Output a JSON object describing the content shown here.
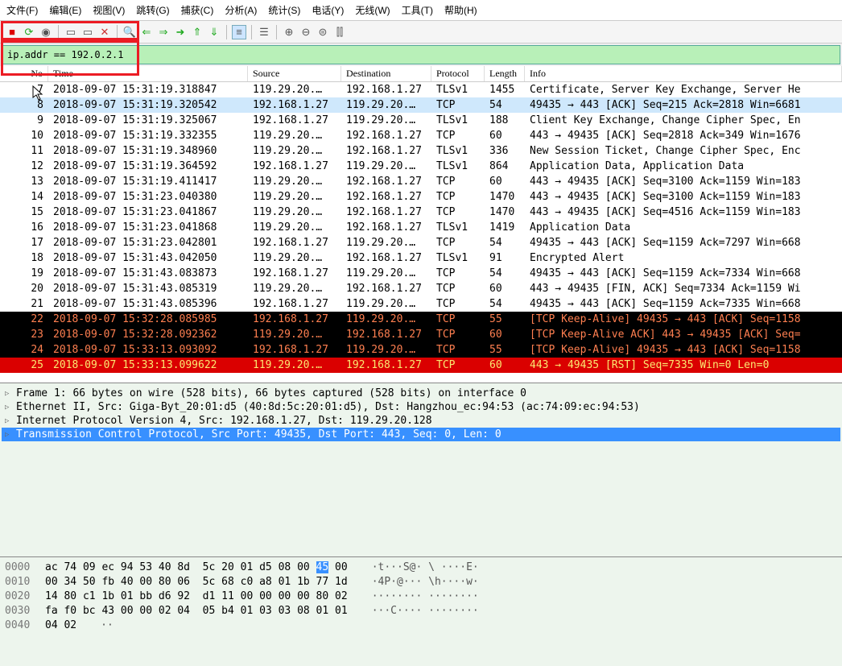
{
  "menu": [
    "文件(F)",
    "编辑(E)",
    "视图(V)",
    "跳转(G)",
    "捕获(C)",
    "分析(A)",
    "统计(S)",
    "电话(Y)",
    "无线(W)",
    "工具(T)",
    "帮助(H)"
  ],
  "filter": {
    "value": "ip.addr == 192.0.2.1"
  },
  "columns": {
    "no": "No",
    "time": "Time",
    "src": "Source",
    "dst": "Destination",
    "proto": "Protocol",
    "len": "Length",
    "info": "Info"
  },
  "packets": [
    {
      "no": 7,
      "time": "2018-09-07 15:31:19.318847",
      "src": "119.29.20.…",
      "dst": "192.168.1.27",
      "proto": "TLSv1",
      "len": 1455,
      "info": "Certificate, Server Key Exchange, Server He",
      "style": "normal"
    },
    {
      "no": 8,
      "time": "2018-09-07 15:31:19.320542",
      "src": "192.168.1.27",
      "dst": "119.29.20.…",
      "proto": "TCP",
      "len": 54,
      "info": "49435 → 443 [ACK] Seq=215 Ack=2818 Win=6681",
      "style": "sel"
    },
    {
      "no": 9,
      "time": "2018-09-07 15:31:19.325067",
      "src": "192.168.1.27",
      "dst": "119.29.20.…",
      "proto": "TLSv1",
      "len": 188,
      "info": "Client Key Exchange, Change Cipher Spec, En",
      "style": "normal"
    },
    {
      "no": 10,
      "time": "2018-09-07 15:31:19.332355",
      "src": "119.29.20.…",
      "dst": "192.168.1.27",
      "proto": "TCP",
      "len": 60,
      "info": "443 → 49435 [ACK] Seq=2818 Ack=349 Win=1676",
      "style": "normal"
    },
    {
      "no": 11,
      "time": "2018-09-07 15:31:19.348960",
      "src": "119.29.20.…",
      "dst": "192.168.1.27",
      "proto": "TLSv1",
      "len": 336,
      "info": "New Session Ticket, Change Cipher Spec, Enc",
      "style": "normal"
    },
    {
      "no": 12,
      "time": "2018-09-07 15:31:19.364592",
      "src": "192.168.1.27",
      "dst": "119.29.20.…",
      "proto": "TLSv1",
      "len": 864,
      "info": "Application Data, Application Data",
      "style": "normal"
    },
    {
      "no": 13,
      "time": "2018-09-07 15:31:19.411417",
      "src": "119.29.20.…",
      "dst": "192.168.1.27",
      "proto": "TCP",
      "len": 60,
      "info": "443 → 49435 [ACK] Seq=3100 Ack=1159 Win=183",
      "style": "normal"
    },
    {
      "no": 14,
      "time": "2018-09-07 15:31:23.040380",
      "src": "119.29.20.…",
      "dst": "192.168.1.27",
      "proto": "TCP",
      "len": 1470,
      "info": "443 → 49435 [ACK] Seq=3100 Ack=1159 Win=183",
      "style": "normal"
    },
    {
      "no": 15,
      "time": "2018-09-07 15:31:23.041867",
      "src": "119.29.20.…",
      "dst": "192.168.1.27",
      "proto": "TCP",
      "len": 1470,
      "info": "443 → 49435 [ACK] Seq=4516 Ack=1159 Win=183",
      "style": "normal"
    },
    {
      "no": 16,
      "time": "2018-09-07 15:31:23.041868",
      "src": "119.29.20.…",
      "dst": "192.168.1.27",
      "proto": "TLSv1",
      "len": 1419,
      "info": "Application Data",
      "style": "normal"
    },
    {
      "no": 17,
      "time": "2018-09-07 15:31:23.042801",
      "src": "192.168.1.27",
      "dst": "119.29.20.…",
      "proto": "TCP",
      "len": 54,
      "info": "49435 → 443 [ACK] Seq=1159 Ack=7297 Win=668",
      "style": "normal"
    },
    {
      "no": 18,
      "time": "2018-09-07 15:31:43.042050",
      "src": "119.29.20.…",
      "dst": "192.168.1.27",
      "proto": "TLSv1",
      "len": 91,
      "info": "Encrypted Alert",
      "style": "normal"
    },
    {
      "no": 19,
      "time": "2018-09-07 15:31:43.083873",
      "src": "192.168.1.27",
      "dst": "119.29.20.…",
      "proto": "TCP",
      "len": 54,
      "info": "49435 → 443 [ACK] Seq=1159 Ack=7334 Win=668",
      "style": "normal"
    },
    {
      "no": 20,
      "time": "2018-09-07 15:31:43.085319",
      "src": "119.29.20.…",
      "dst": "192.168.1.27",
      "proto": "TCP",
      "len": 60,
      "info": "443 → 49435 [FIN, ACK] Seq=7334 Ack=1159 Wi",
      "style": "normal"
    },
    {
      "no": 21,
      "time": "2018-09-07 15:31:43.085396",
      "src": "192.168.1.27",
      "dst": "119.29.20.…",
      "proto": "TCP",
      "len": 54,
      "info": "49435 → 443 [ACK] Seq=1159 Ack=7335 Win=668",
      "style": "normal"
    },
    {
      "no": 22,
      "time": "2018-09-07 15:32:28.085985",
      "src": "192.168.1.27",
      "dst": "119.29.20.…",
      "proto": "TCP",
      "len": 55,
      "info": "[TCP Keep-Alive] 49435 → 443 [ACK] Seq=1158",
      "style": "black"
    },
    {
      "no": 23,
      "time": "2018-09-07 15:32:28.092362",
      "src": "119.29.20.…",
      "dst": "192.168.1.27",
      "proto": "TCP",
      "len": 60,
      "info": "[TCP Keep-Alive ACK] 443 → 49435 [ACK] Seq=",
      "style": "black"
    },
    {
      "no": 24,
      "time": "2018-09-07 15:33:13.093092",
      "src": "192.168.1.27",
      "dst": "119.29.20.…",
      "proto": "TCP",
      "len": 55,
      "info": "[TCP Keep-Alive] 49435 → 443 [ACK] Seq=1158",
      "style": "black"
    },
    {
      "no": 25,
      "time": "2018-09-07 15:33:13.099622",
      "src": "119.29.20.…",
      "dst": "192.168.1.27",
      "proto": "TCP",
      "len": 60,
      "info": "443 → 49435 [RST] Seq=7335 Win=0 Len=0",
      "style": "red"
    }
  ],
  "details": [
    {
      "text": "Frame 1: 66 bytes on wire (528 bits), 66 bytes captured (528 bits) on interface 0",
      "sel": false
    },
    {
      "text": "Ethernet II, Src: Giga-Byt_20:01:d5 (40:8d:5c:20:01:d5), Dst: Hangzhou_ec:94:53 (ac:74:09:ec:94:53)",
      "sel": false
    },
    {
      "text": "Internet Protocol Version 4, Src: 192.168.1.27, Dst: 119.29.20.128",
      "sel": false
    },
    {
      "text": "Transmission Control Protocol, Src Port: 49435, Dst Port: 443, Seq: 0, Len: 0",
      "sel": true
    }
  ],
  "hex": [
    {
      "off": "0000",
      "b": "ac 74 09 ec 94 53 40 8d  5c 20 01 d5 08 00 ",
      "hl": "45",
      "b2": " 00",
      "asc": "·t···S@· \\ ····E·"
    },
    {
      "off": "0010",
      "b": "00 34 50 fb 40 00 80 06  5c 68 c0 a8 01 1b 77 1d",
      "hl": "",
      "b2": "",
      "asc": "·4P·@··· \\h····w·"
    },
    {
      "off": "0020",
      "b": "14 80 c1 1b 01 bb d6 92  d1 11 00 00 00 00 80 02",
      "hl": "",
      "b2": "",
      "asc": "········ ········"
    },
    {
      "off": "0030",
      "b": "fa f0 bc 43 00 00 02 04  05 b4 01 03 03 08 01 01",
      "hl": "",
      "b2": "",
      "asc": "···C···· ········"
    },
    {
      "off": "0040",
      "b": "04 02",
      "hl": "",
      "b2": "",
      "asc": "··"
    }
  ]
}
